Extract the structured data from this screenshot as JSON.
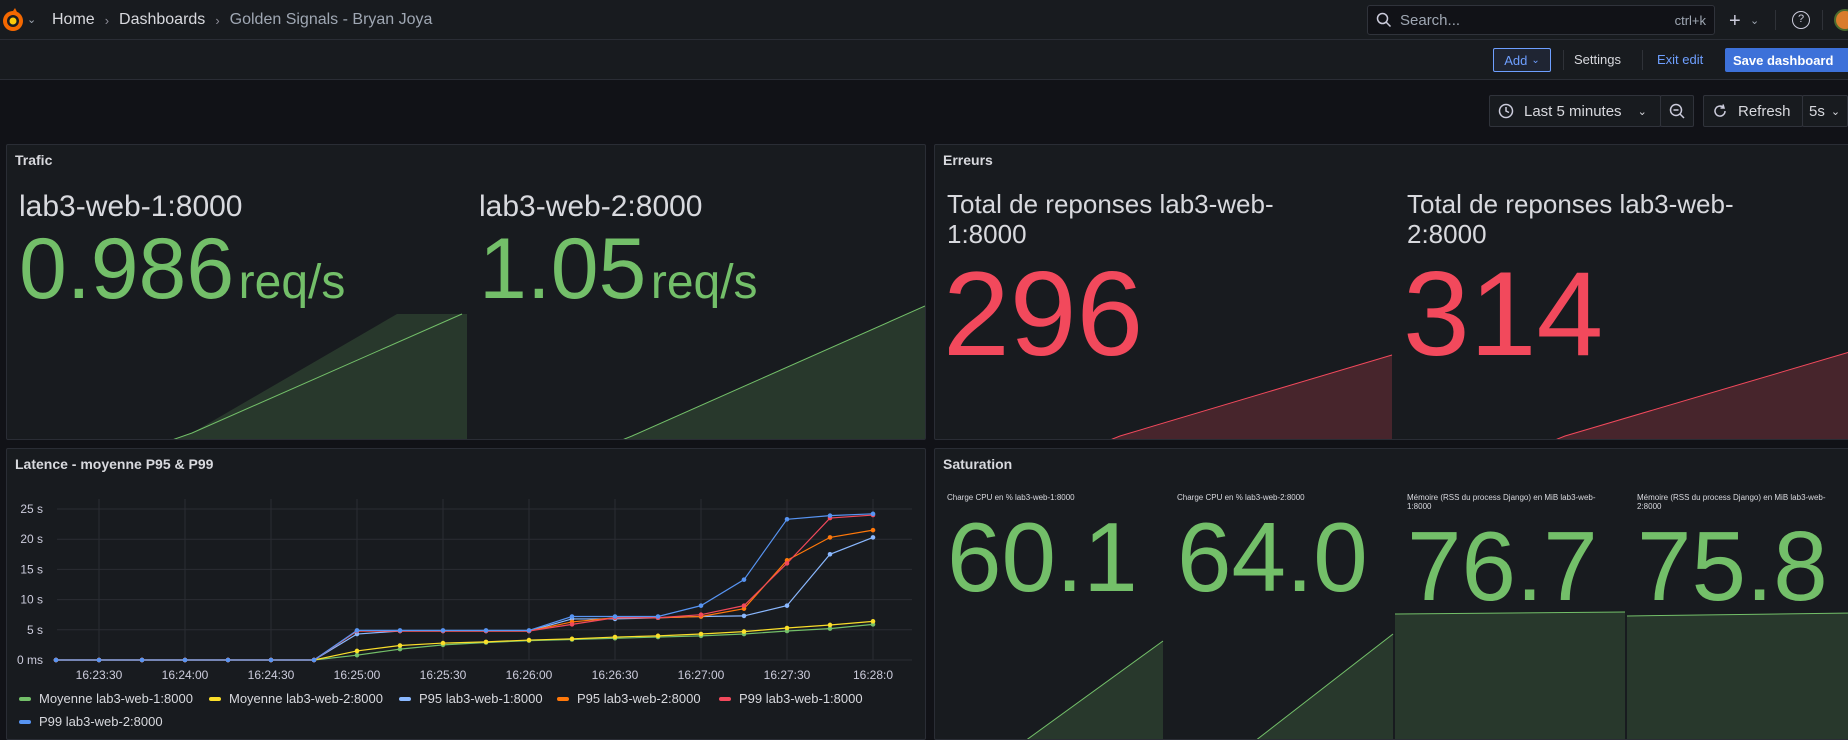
{
  "topbar": {
    "breadcrumbs": [
      "Home",
      "Dashboards",
      "Golden Signals - Bryan Joya"
    ],
    "search_placeholder": "Search...",
    "search_shortcut": "ctrl+k",
    "help_label": "?"
  },
  "toolbar": {
    "add_label": "Add",
    "settings_label": "Settings",
    "exit_label": "Exit edit",
    "save_label": "Save dashboard"
  },
  "timecontrols": {
    "range_label": "Last 5 minutes",
    "refresh_label": "Refresh",
    "interval_label": "5s"
  },
  "colors": {
    "green": "#73bf69",
    "red": "#f2495c",
    "yellow": "#fade2a",
    "blue": "#8ab8ff",
    "orange": "#ff780a",
    "darkblue": "#5794f2"
  },
  "panels": {
    "trafic": {
      "title": "Trafic",
      "stats": [
        {
          "label": "lab3-web-1:8000",
          "value": "0.986",
          "unit": "req/s"
        },
        {
          "label": "lab3-web-2:8000",
          "value": "1.05",
          "unit": "req/s"
        }
      ]
    },
    "erreurs": {
      "title": "Erreurs",
      "stats": [
        {
          "label_line1": "Total de reponses lab3-web-",
          "label_line2": "1:8000",
          "value": "296"
        },
        {
          "label_line1": "Total de reponses lab3-web-",
          "label_line2": "2:8000",
          "value": "314"
        }
      ]
    },
    "saturation": {
      "title": "Saturation",
      "stats": [
        {
          "label_line1": "Charge CPU en % lab3-web-1:8000",
          "label_line2": "",
          "value": "60.1"
        },
        {
          "label_line1": "Charge CPU en % lab3-web-2:8000",
          "label_line2": "",
          "value": "64.0"
        },
        {
          "label_line1": "Mémoire (RSS du process Django) en MiB lab3-web-",
          "label_line2": "1:8000",
          "value": "76.7"
        },
        {
          "label_line1": "Mémoire (RSS du process Django) en MiB lab3-web-",
          "label_line2": "2:8000",
          "value": "75.8"
        }
      ]
    },
    "latence": {
      "title": "Latence - moyenne P95 & P99",
      "legend": [
        "Moyenne lab3-web-1:8000",
        "Moyenne lab3-web-2:8000",
        "P95 lab3-web-1:8000",
        "P95 lab3-web-2:8000",
        "P99 lab3-web-1:8000",
        "P99 lab3-web-2:8000"
      ]
    }
  },
  "chart_data": {
    "type": "line",
    "title": "Latence - moyenne P95 & P99",
    "ylim": [
      0,
      25
    ],
    "yticks": [
      "0 ms",
      "5 s",
      "10 s",
      "15 s",
      "20 s",
      "25 s"
    ],
    "xticks": [
      "16:23:30",
      "16:24:00",
      "16:24:30",
      "16:25:00",
      "16:25:30",
      "16:26:00",
      "16:26:30",
      "16:27:00",
      "16:27:30",
      "16:28:0"
    ],
    "x": [
      "16:23:15",
      "16:23:30",
      "16:23:45",
      "16:24:00",
      "16:24:15",
      "16:24:30",
      "16:24:45",
      "16:25:00",
      "16:25:15",
      "16:25:30",
      "16:25:45",
      "16:26:00",
      "16:26:15",
      "16:26:30",
      "16:26:45",
      "16:27:00",
      "16:27:15",
      "16:27:30",
      "16:27:45",
      "16:28:00"
    ],
    "grid": true,
    "legend_position": "bottom",
    "series": [
      {
        "name": "Moyenne lab3-web-1:8000",
        "color": "#73bf69",
        "values": [
          0,
          0,
          0,
          0,
          0,
          0,
          0,
          0.8,
          1.8,
          2.5,
          2.9,
          3.2,
          3.4,
          3.6,
          3.8,
          4.0,
          4.3,
          4.8,
          5.2,
          5.9
        ]
      },
      {
        "name": "Moyenne lab3-web-2:8000",
        "color": "#fade2a",
        "values": [
          0,
          0,
          0,
          0,
          0,
          0,
          0,
          1.5,
          2.4,
          2.8,
          3.0,
          3.3,
          3.5,
          3.8,
          4.0,
          4.3,
          4.7,
          5.3,
          5.8,
          6.4
        ]
      },
      {
        "name": "P95 lab3-web-1:8000",
        "color": "#8ab8ff",
        "values": [
          0,
          0,
          0,
          0,
          0,
          0,
          0,
          4.3,
          4.8,
          4.8,
          4.8,
          4.8,
          6.8,
          6.8,
          7.0,
          7.2,
          7.3,
          9.0,
          17.5,
          20.3
        ]
      },
      {
        "name": "P95 lab3-web-2:8000",
        "color": "#ff780a",
        "values": [
          0,
          0,
          0,
          0,
          0,
          0,
          0,
          4.8,
          4.8,
          4.8,
          4.8,
          4.8,
          6.3,
          7.0,
          7.0,
          7.2,
          8.5,
          16.5,
          20.3,
          21.5
        ]
      },
      {
        "name": "P99 lab3-web-1:8000",
        "color": "#f2495c",
        "values": [
          0,
          0,
          0,
          0,
          0,
          0,
          0,
          4.8,
          4.8,
          4.8,
          4.8,
          4.8,
          5.9,
          7.0,
          7.0,
          7.5,
          9.0,
          16.0,
          23.5,
          24.0
        ]
      },
      {
        "name": "P99 lab3-web-2:8000",
        "color": "#5794f2",
        "values": [
          0,
          0,
          0,
          0,
          0,
          0,
          0,
          4.9,
          4.9,
          4.9,
          4.9,
          4.9,
          7.2,
          7.2,
          7.2,
          9.0,
          13.3,
          23.3,
          23.9,
          24.2
        ]
      }
    ]
  }
}
